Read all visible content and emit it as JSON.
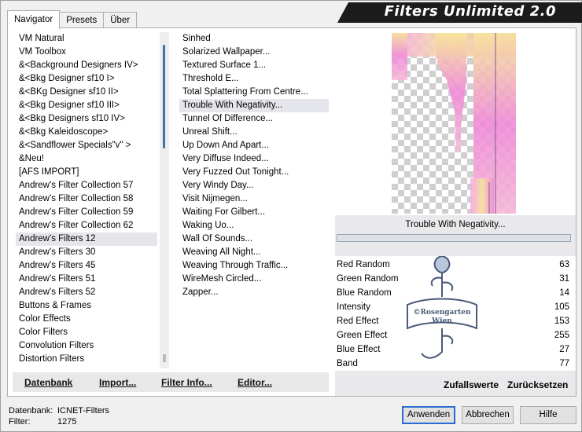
{
  "app": {
    "title": "Filters Unlimited 2.0"
  },
  "tabs": [
    {
      "label": "Navigator",
      "active": true
    },
    {
      "label": "Presets",
      "active": false
    },
    {
      "label": "Über",
      "active": false
    }
  ],
  "categories": [
    {
      "label": "VM Natural"
    },
    {
      "label": "VM Toolbox"
    },
    {
      "label": "&<Background Designers IV>"
    },
    {
      "label": "&<Bkg Designer sf10 I>"
    },
    {
      "label": "&<BKg Designer sf10 II>"
    },
    {
      "label": "&<Bkg Designer sf10 III>"
    },
    {
      "label": "&<Bkg Designers sf10 IV>"
    },
    {
      "label": "&<Bkg Kaleidoscope>"
    },
    {
      "label": "&<Sandflower Specials\"v\" >"
    },
    {
      "label": "&Neu!"
    },
    {
      "label": "[AFS IMPORT]"
    },
    {
      "label": "Andrew's Filter Collection 57"
    },
    {
      "label": "Andrew's Filter Collection 58"
    },
    {
      "label": "Andrew's Filter Collection 59"
    },
    {
      "label": "Andrew's Filter Collection 62"
    },
    {
      "label": "Andrew's Filters 12",
      "selected": true
    },
    {
      "label": "Andrew's Filters 30"
    },
    {
      "label": "Andrew's Filters 45"
    },
    {
      "label": "Andrew's Filters 51"
    },
    {
      "label": "Andrew's Filters 52"
    },
    {
      "label": "Buttons & Frames"
    },
    {
      "label": "Color Effects"
    },
    {
      "label": "Color Filters"
    },
    {
      "label": "Convolution Filters"
    },
    {
      "label": "Distortion Filters"
    }
  ],
  "filters": [
    {
      "label": "Sinhed"
    },
    {
      "label": "Solarized Wallpaper..."
    },
    {
      "label": "Textured Surface 1..."
    },
    {
      "label": "Threshold E..."
    },
    {
      "label": "Total Splattering From Centre..."
    },
    {
      "label": "Trouble With Negativity...",
      "selected": true
    },
    {
      "label": "Tunnel Of Difference..."
    },
    {
      "label": "Unreal Shift..."
    },
    {
      "label": "Up Down And Apart..."
    },
    {
      "label": "Very Diffuse Indeed..."
    },
    {
      "label": "Very Fuzzed Out Tonight..."
    },
    {
      "label": "Very Windy Day..."
    },
    {
      "label": "Visit Nijmegen..."
    },
    {
      "label": "Waiting For Gilbert..."
    },
    {
      "label": "Waking Uo..."
    },
    {
      "label": "Wall Of Sounds..."
    },
    {
      "label": "Weaving All Night..."
    },
    {
      "label": "Weaving Through Traffic..."
    },
    {
      "label": "WireMesh Circled..."
    },
    {
      "label": "Zapper..."
    }
  ],
  "bottom_buttons": {
    "datenbank": "Datenbank",
    "import": "Import...",
    "filter_info": "Filter Info...",
    "editor": "Editor..."
  },
  "preview": {
    "filter_name": "Trouble With Negativity..."
  },
  "params": [
    {
      "name": "Red Random",
      "value": "63"
    },
    {
      "name": "Green Random",
      "value": "31"
    },
    {
      "name": "Blue Random",
      "value": "14"
    },
    {
      "name": "Intensity",
      "value": "105"
    },
    {
      "name": "Red Effect",
      "value": "153"
    },
    {
      "name": "Green Effect",
      "value": "255"
    },
    {
      "name": "Blue Effect",
      "value": "27"
    },
    {
      "name": "Band",
      "value": "77"
    }
  ],
  "watermark": {
    "text_line1": "©Rosengarten",
    "text_line2": "Wien"
  },
  "right_buttons": {
    "zufallswerte": "Zufallswerte",
    "zuruecksetzen": "Zurücksetzen"
  },
  "status": {
    "db_label": "Datenbank:",
    "db_value": "ICNET-Filters",
    "filter_label": "Filter:",
    "filter_value": "1275"
  },
  "dialog_buttons": {
    "apply": "Anwenden",
    "cancel": "Abbrechen",
    "help": "Hilfe"
  },
  "colors": {
    "banner_bg": "#1b1b1b",
    "selection": "#e5e5ec",
    "scroll_thumb": "#4a6fa8",
    "default_button_border": "#2b6cd2",
    "preview_pink": "#f08ad8",
    "preview_yellow": "#f7e69a"
  }
}
